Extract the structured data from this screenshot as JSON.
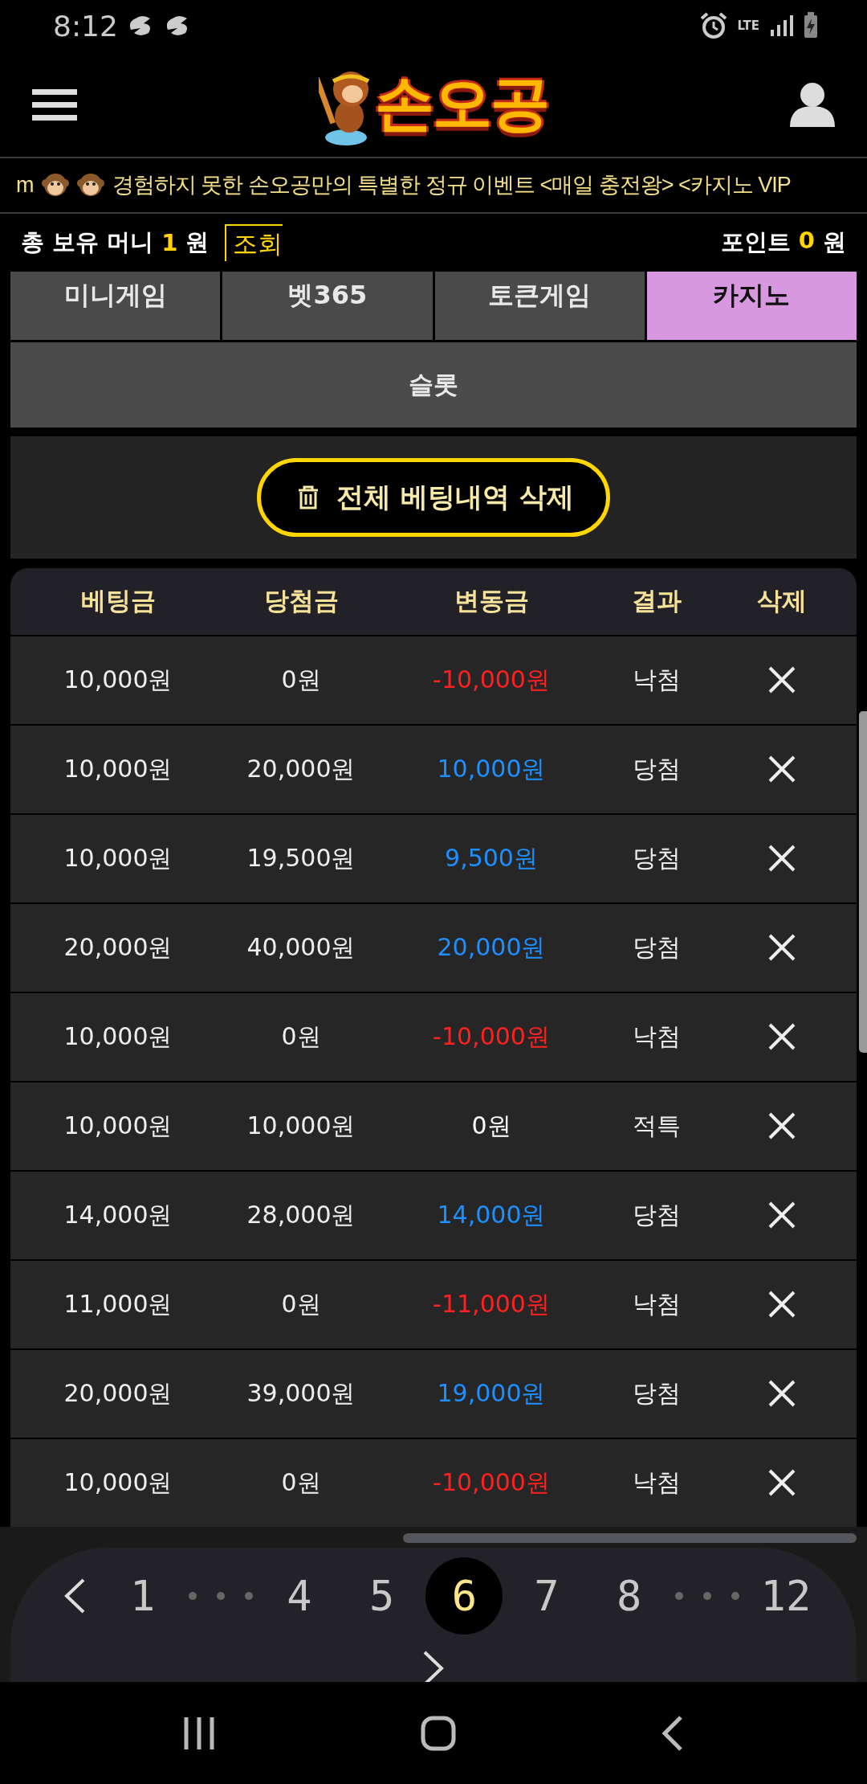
{
  "status_bar": {
    "time": "8:12",
    "network": "LTE"
  },
  "header": {
    "logo": "손오공"
  },
  "marquee": [
    {
      "kind": "text",
      "text": "m"
    },
    {
      "kind": "icon"
    },
    {
      "kind": "icon"
    },
    {
      "kind": "text",
      "text": "경험하지 못한 손오공만의 특별한 정규 이벤트 <매일 충전왕> <카지노 VIP"
    }
  ],
  "balance": {
    "label": "총 보유 머니",
    "amount": "1",
    "unit": "원",
    "check_button": "조회",
    "points_label": "포인트",
    "points": "0",
    "points_unit": "원"
  },
  "tabs": [
    {
      "label": "미니게임",
      "selected": false
    },
    {
      "label": "벳365",
      "selected": false
    },
    {
      "label": "토큰게임",
      "selected": false
    },
    {
      "label": "카지노",
      "selected": true
    }
  ],
  "subtabs": [
    {
      "label": "슬롯",
      "selected": false
    }
  ],
  "delete_all_button": "전체 베팅내역 삭제",
  "table": {
    "columns": [
      "베팅금",
      "당첨금",
      "변동금",
      "결과",
      "삭제"
    ],
    "rows": [
      {
        "bet": "10,000원",
        "win": "0원",
        "change": {
          "text": "-10,000원",
          "color": "#ff2020"
        },
        "result": "낙첨"
      },
      {
        "bet": "10,000원",
        "win": "20,000원",
        "change": {
          "text": "10,000원",
          "color": "#1e8fff"
        },
        "result": "당첨"
      },
      {
        "bet": "10,000원",
        "win": "19,500원",
        "change": {
          "text": "9,500원",
          "color": "#1e8fff"
        },
        "result": "당첨"
      },
      {
        "bet": "20,000원",
        "win": "40,000원",
        "change": {
          "text": "20,000원",
          "color": "#1e8fff"
        },
        "result": "당첨"
      },
      {
        "bet": "10,000원",
        "win": "0원",
        "change": {
          "text": "-10,000원",
          "color": "#ff2020"
        },
        "result": "낙첨"
      },
      {
        "bet": "10,000원",
        "win": "10,000원",
        "change": {
          "text": "0원",
          "color": "#ffffff"
        },
        "result": "적특"
      },
      {
        "bet": "14,000원",
        "win": "28,000원",
        "change": {
          "text": "14,000원",
          "color": "#1e8fff"
        },
        "result": "당첨"
      },
      {
        "bet": "11,000원",
        "win": "0원",
        "change": {
          "text": "-11,000원",
          "color": "#ff2020"
        },
        "result": "낙첨"
      },
      {
        "bet": "20,000원",
        "win": "39,000원",
        "change": {
          "text": "19,000원",
          "color": "#1e8fff"
        },
        "result": "당첨"
      },
      {
        "bet": "10,000원",
        "win": "0원",
        "change": {
          "text": "-10,000원",
          "color": "#ff2020"
        },
        "result": "낙첨"
      }
    ]
  },
  "pagination": [
    {
      "kind": "prev"
    },
    {
      "kind": "page",
      "label": "1",
      "selected": false
    },
    {
      "kind": "gap"
    },
    {
      "kind": "page",
      "label": "4",
      "selected": false
    },
    {
      "kind": "page",
      "label": "5",
      "selected": false
    },
    {
      "kind": "page",
      "label": "6",
      "selected": true
    },
    {
      "kind": "page",
      "label": "7",
      "selected": false
    },
    {
      "kind": "page",
      "label": "8",
      "selected": false
    },
    {
      "kind": "gap"
    },
    {
      "kind": "page",
      "label": "12",
      "selected": false
    },
    {
      "kind": "next"
    }
  ]
}
